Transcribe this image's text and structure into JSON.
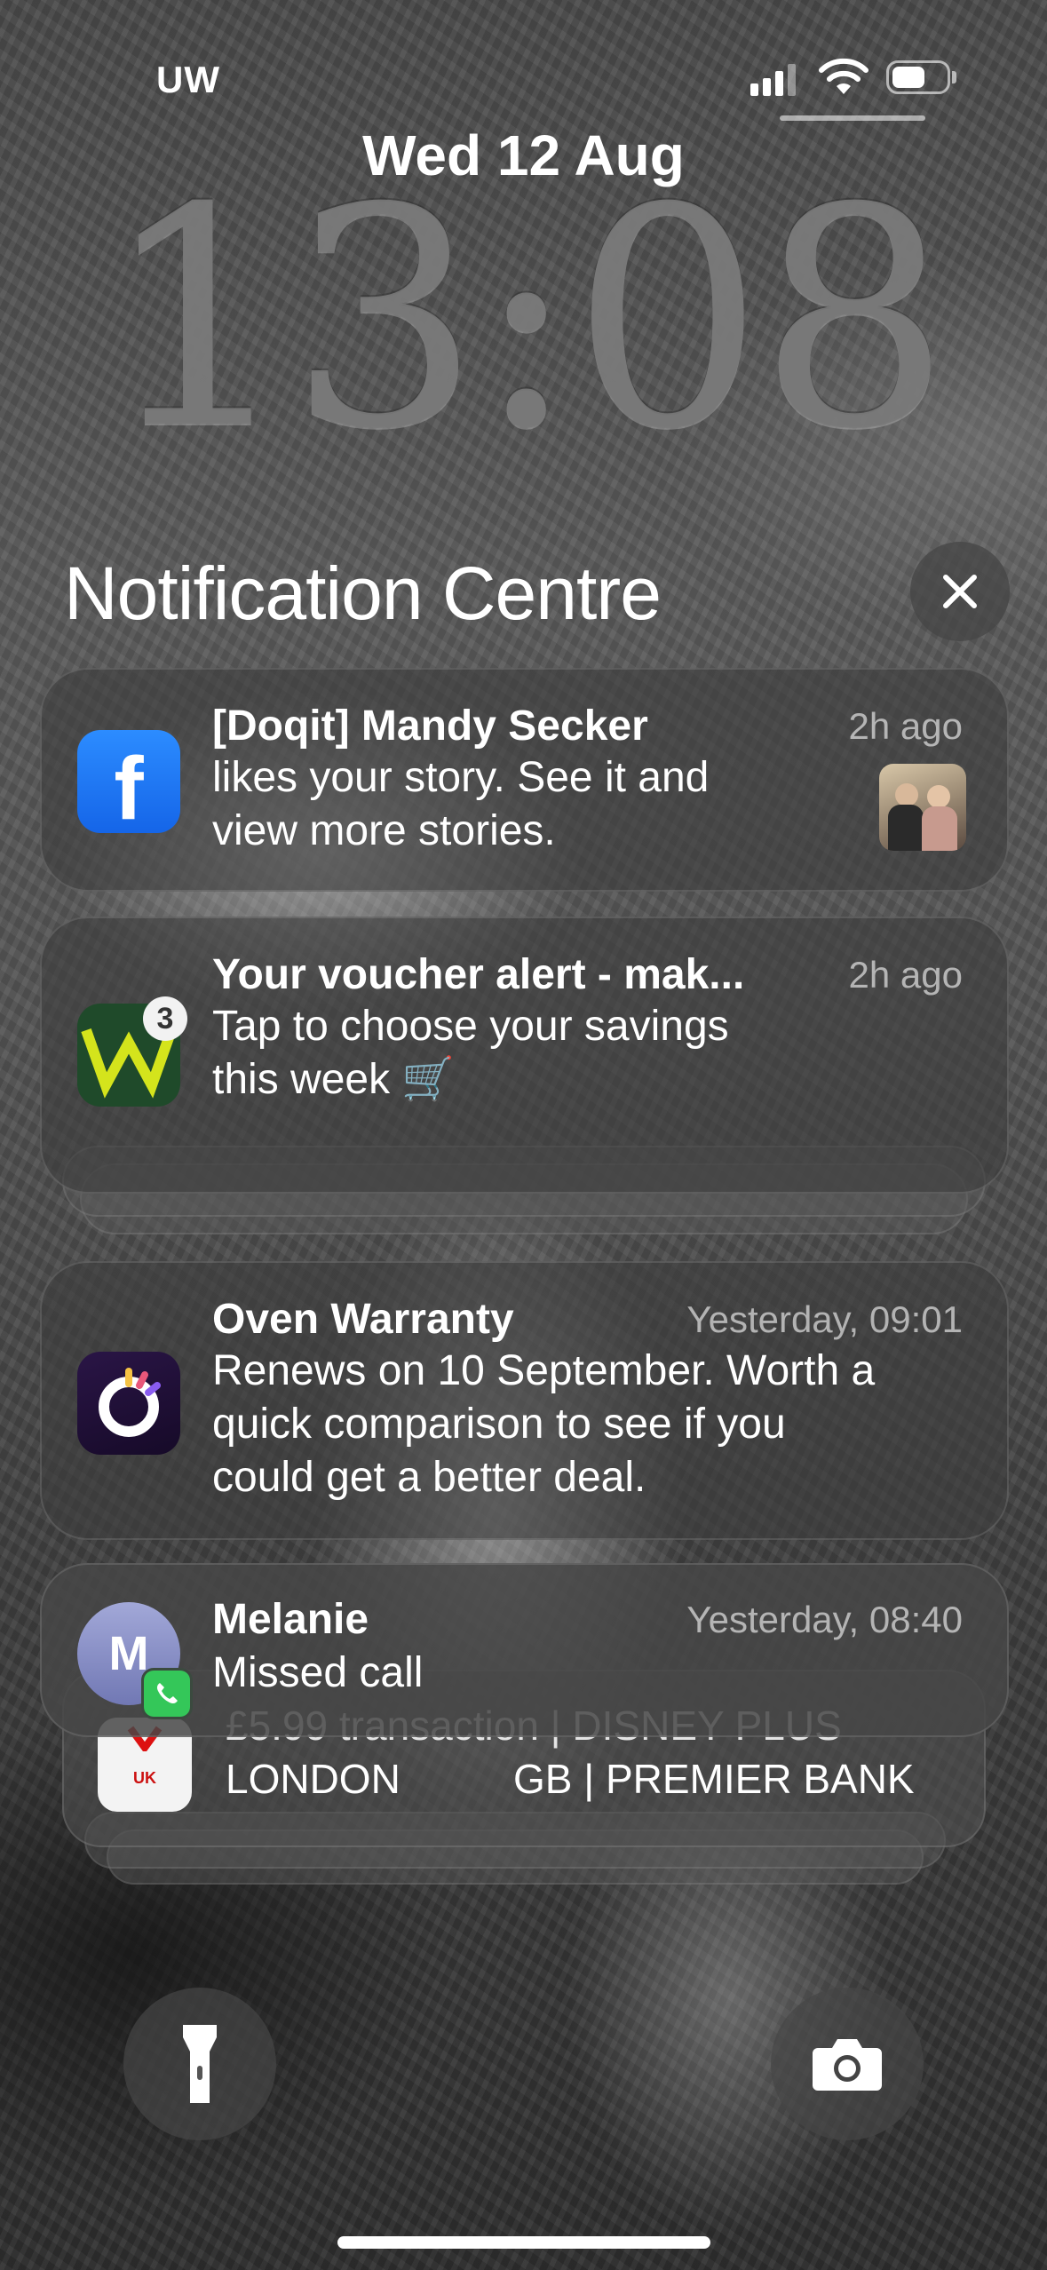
{
  "status_bar": {
    "carrier": "UW"
  },
  "lock_screen": {
    "date": "Wed 12 Aug",
    "time": "13:08"
  },
  "notification_centre": {
    "title": "Notification Centre"
  },
  "notifications": [
    {
      "app_icon": "facebook-icon",
      "title": "[Doqit] Mandy Secker",
      "time": "2h ago",
      "body": [
        "likes your story. See it and",
        "view more stories."
      ]
    },
    {
      "app_icon": "waitrose-icon",
      "badge": "3",
      "title": "Your voucher alert - mak...",
      "time": "2h ago",
      "body": [
        "Tap to choose your savings",
        "this week 🛒"
      ]
    },
    {
      "app_icon": "insurance-app-icon",
      "title": "Oven Warranty",
      "time": "Yesterday, 09:01",
      "body": [
        "Renews on 10 September. Worth a",
        "quick comparison to see if you",
        "could get a better deal."
      ]
    },
    {
      "app_icon": "phone-icon",
      "avatar_letter": "M",
      "title": "Melanie",
      "time": "Yesterday, 08:40",
      "body": [
        "Missed call"
      ]
    }
  ],
  "stacked_notification": {
    "icon_label": "UK",
    "line1": "£5.99 transaction | DISNEY PLUS",
    "line2_left": "LONDON",
    "line2_right": "GB | PREMIER BANK"
  },
  "colors": {
    "facebook_blue": "#1877F2",
    "waitrose_green": "#1f4a2a",
    "waitrose_yellow": "#d4e41c",
    "phone_green": "#34c759"
  }
}
